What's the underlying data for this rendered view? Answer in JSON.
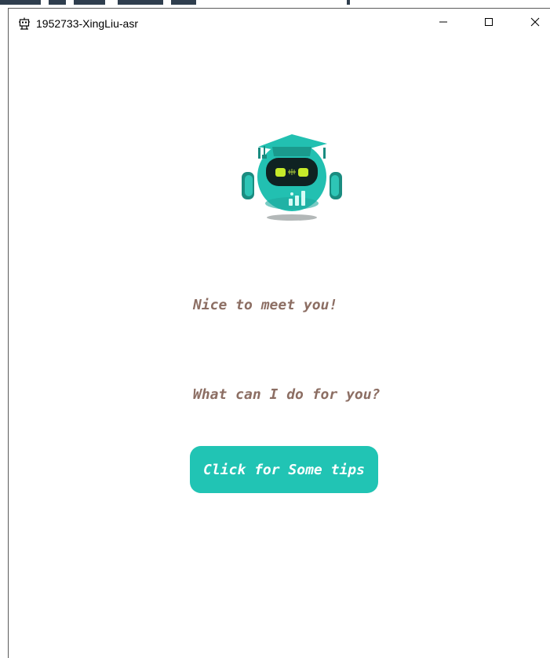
{
  "window": {
    "title": "1952733-XingLiu-asr"
  },
  "titlebar": {
    "app_icon": "robot-icon",
    "buttons": [
      "minimize-icon",
      "maximize-icon",
      "close-icon"
    ]
  },
  "main": {
    "mascot": "robot-mascot-icon",
    "greeting": "Nice to meet you!",
    "question": "What can I do for you?",
    "tips_button_label": "Click for Some tips"
  },
  "colors": {
    "accent": "#21c4b4",
    "text": "#8c6e63",
    "button_text": "#ffffff"
  }
}
